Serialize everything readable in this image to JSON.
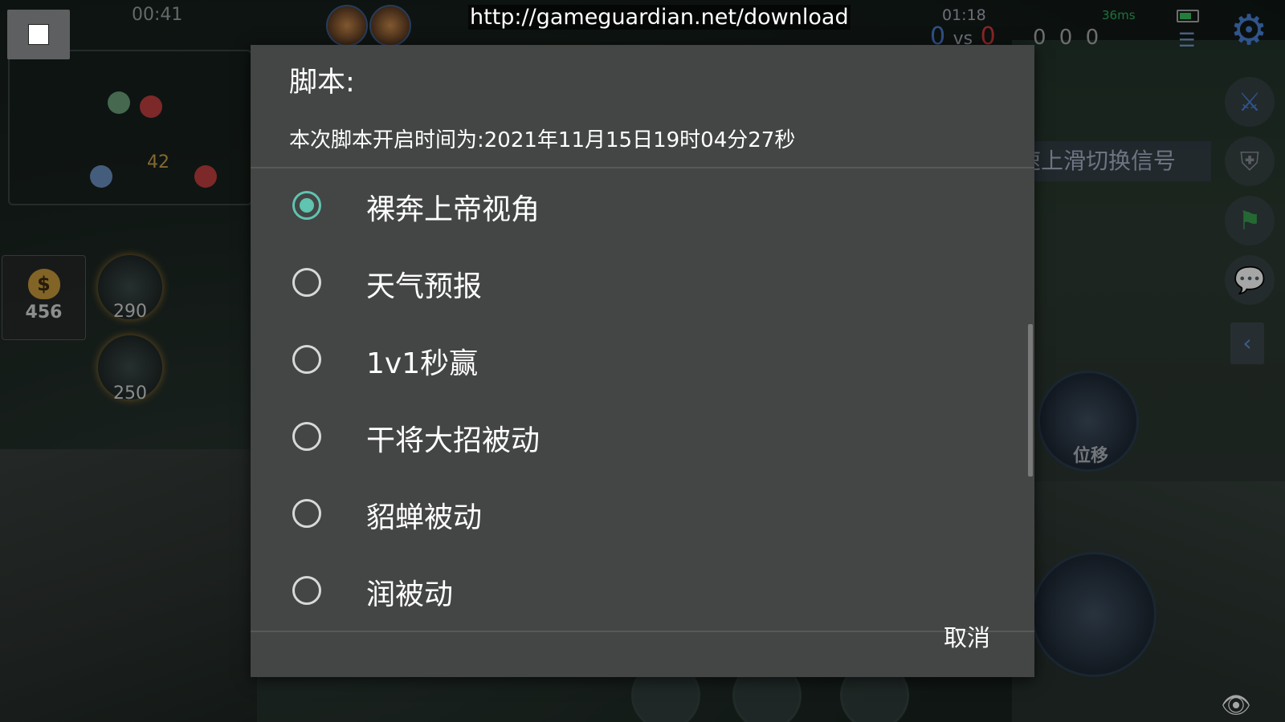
{
  "game": {
    "timer": "00:41",
    "minimap_number": "42",
    "gold": "456",
    "item_prices": [
      "290",
      "250"
    ],
    "clock": "01:18",
    "score_blue": "0",
    "score_vs": "vs",
    "score_red": "0",
    "ping": "36ms",
    "kda": "0 0 0",
    "swipe_hint": "速上滑切换信号",
    "skill_label": "位移",
    "url": "http://gameguardian.net/download"
  },
  "icons": {
    "stop": "stop-square-icon",
    "settings": "gear-icon",
    "list": "list-icon",
    "attack": "sword-icon",
    "defend": "shield-icon",
    "flag": "flag-icon",
    "chat": "chat-bubble-icon",
    "back": "chevron-left-icon",
    "eye": "eye-icon"
  },
  "dialog": {
    "title": "脚本:",
    "subtitle": "本次脚本开启时间为:2021年11月15日19时04分27秒",
    "options": [
      {
        "label": "裸奔上帝视角",
        "selected": true
      },
      {
        "label": "天气预报",
        "selected": false
      },
      {
        "label": "1v1秒赢",
        "selected": false
      },
      {
        "label": "干将大招被动",
        "selected": false
      },
      {
        "label": "貂蝉被动",
        "selected": false
      },
      {
        "label": "润被动",
        "selected": false
      }
    ],
    "cancel_label": "取消"
  },
  "colors": {
    "accent": "#5fc4b0",
    "dialog_bg": "#444545",
    "blue_team": "#4c7bd0",
    "red_team": "#d43a3a"
  }
}
